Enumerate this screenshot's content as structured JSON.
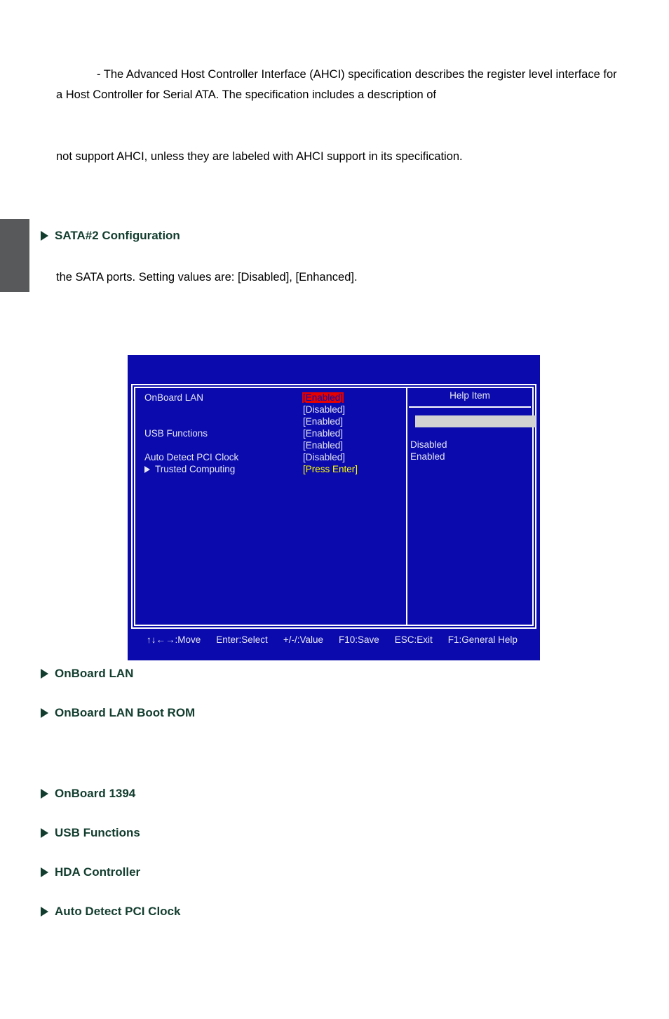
{
  "document": {
    "paragraphs": {
      "intro": "- The Advanced Host Controller Interface (AHCI) specification describes the register level interface for a Host Controller for Serial ATA. The specification includes a description of",
      "ahci_note": "not support AHCI, unless they are labeled with AHCI support in its specification.",
      "sata_note": "the SATA ports. Setting values are: [Disabled], [Enhanced]."
    },
    "headings": [
      {
        "id": "sata2-configuration",
        "label": "SATA#2 Configuration"
      },
      {
        "id": "onboard-lan",
        "label": "OnBoard LAN"
      },
      {
        "id": "onboard-lan-boot-rom",
        "label": "OnBoard LAN Boot ROM"
      },
      {
        "id": "onboard-1394",
        "label": "OnBoard 1394"
      },
      {
        "id": "usb-functions",
        "label": "USB Functions"
      },
      {
        "id": "hda-controller",
        "label": "HDA Controller"
      },
      {
        "id": "auto-detect-pci-clock",
        "label": "Auto Detect PCI Clock"
      }
    ]
  },
  "bios": {
    "colors": {
      "background": "#0a0aad",
      "text": "#e8e8f2",
      "selection": "#e60000",
      "press_enter": "#ffff00",
      "help_bar": "#d2d2d2"
    },
    "settings": [
      {
        "label": "OnBoard LAN",
        "value": "[Enabled]",
        "state": "selected",
        "arrow": false
      },
      {
        "label": "",
        "value": "[Disabled]",
        "state": "normal",
        "arrow": false
      },
      {
        "label": "",
        "value": "[Enabled]",
        "state": "normal",
        "arrow": false
      },
      {
        "label": "USB Functions",
        "value": "[Enabled]",
        "state": "normal",
        "arrow": false
      },
      {
        "label": "",
        "value": "[Enabled]",
        "state": "normal",
        "arrow": false
      },
      {
        "label": "Auto Detect PCI Clock",
        "value": "[Disabled]",
        "state": "normal",
        "arrow": false
      },
      {
        "label": "Trusted Computing",
        "value": "[Press Enter]",
        "state": "press",
        "arrow": true
      }
    ],
    "help": {
      "title": "Help Item",
      "options": [
        "Disabled",
        "Enabled"
      ]
    },
    "legend": [
      "↑↓←→:Move",
      "Enter:Select",
      "+/-/:Value",
      "F10:Save",
      "ESC:Exit",
      "F1:General Help"
    ]
  }
}
